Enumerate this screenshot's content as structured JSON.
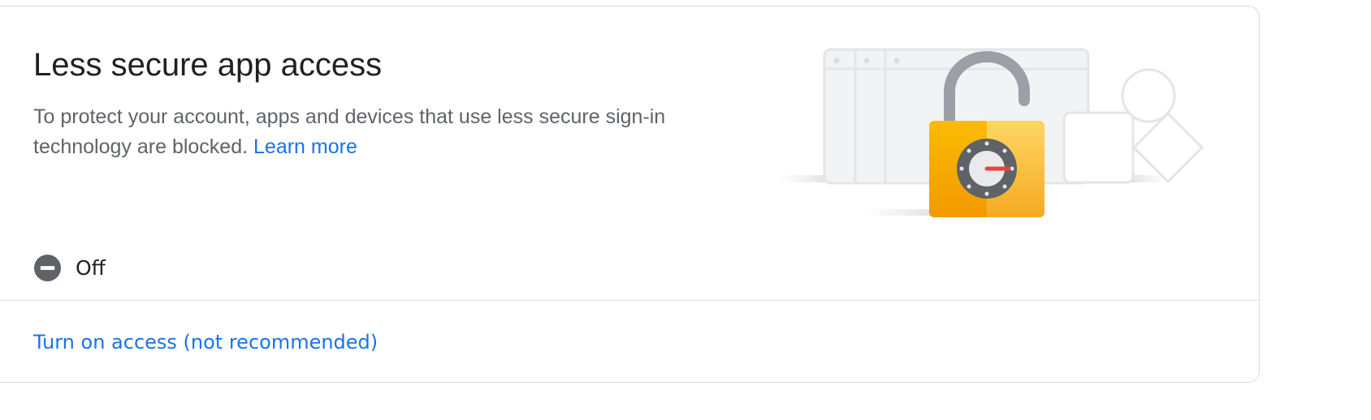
{
  "card": {
    "title": "Less secure app access",
    "description": "To protect your account, apps and devices that use less secure sign-in technology are blocked.",
    "learn_more_label": "Learn more",
    "status": {
      "icon": "remove-circle-icon",
      "label": "Off"
    },
    "action_label": "Turn on access (not recommended)"
  },
  "illustration": {
    "name": "unlocked-padlock-illustration"
  },
  "colors": {
    "link": "#1a73e8",
    "title": "#202124",
    "body_text": "#5f6368",
    "divider": "#dadce0",
    "padlock_yellow": "#f9ab00",
    "dial_needle": "#ea4335"
  }
}
